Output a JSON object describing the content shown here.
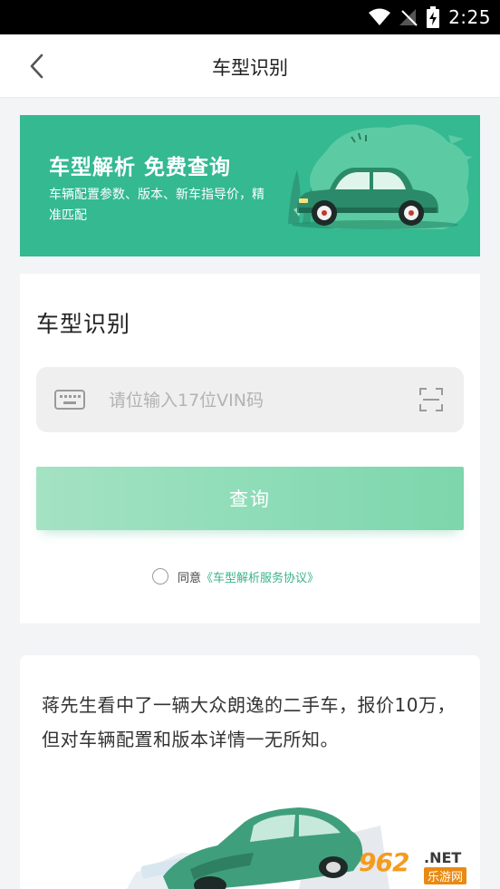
{
  "status_bar": {
    "time": "2:25"
  },
  "header": {
    "title": "车型识别"
  },
  "banner": {
    "title": "车型解析 免费查询",
    "description": "车辆配置参数、版本、新车指导价，精准匹配"
  },
  "vin_card": {
    "title": "车型识别",
    "vin_placeholder": "请位输入17位VIN码",
    "query_label": "查询",
    "agree_text": "同意",
    "agreement_link": "《车型解析服务协议》"
  },
  "story_card": {
    "text": "蒋先生看中了一辆大众朗逸的二手车，报价10万，但对车辆配置和版本详情一无所知。"
  },
  "watermark": {
    "number": "962",
    "suffix": ".NET",
    "site": "乐游网"
  },
  "colors": {
    "accent": "#34b991",
    "link": "#3bb38a",
    "button": "#8ddcb7"
  }
}
